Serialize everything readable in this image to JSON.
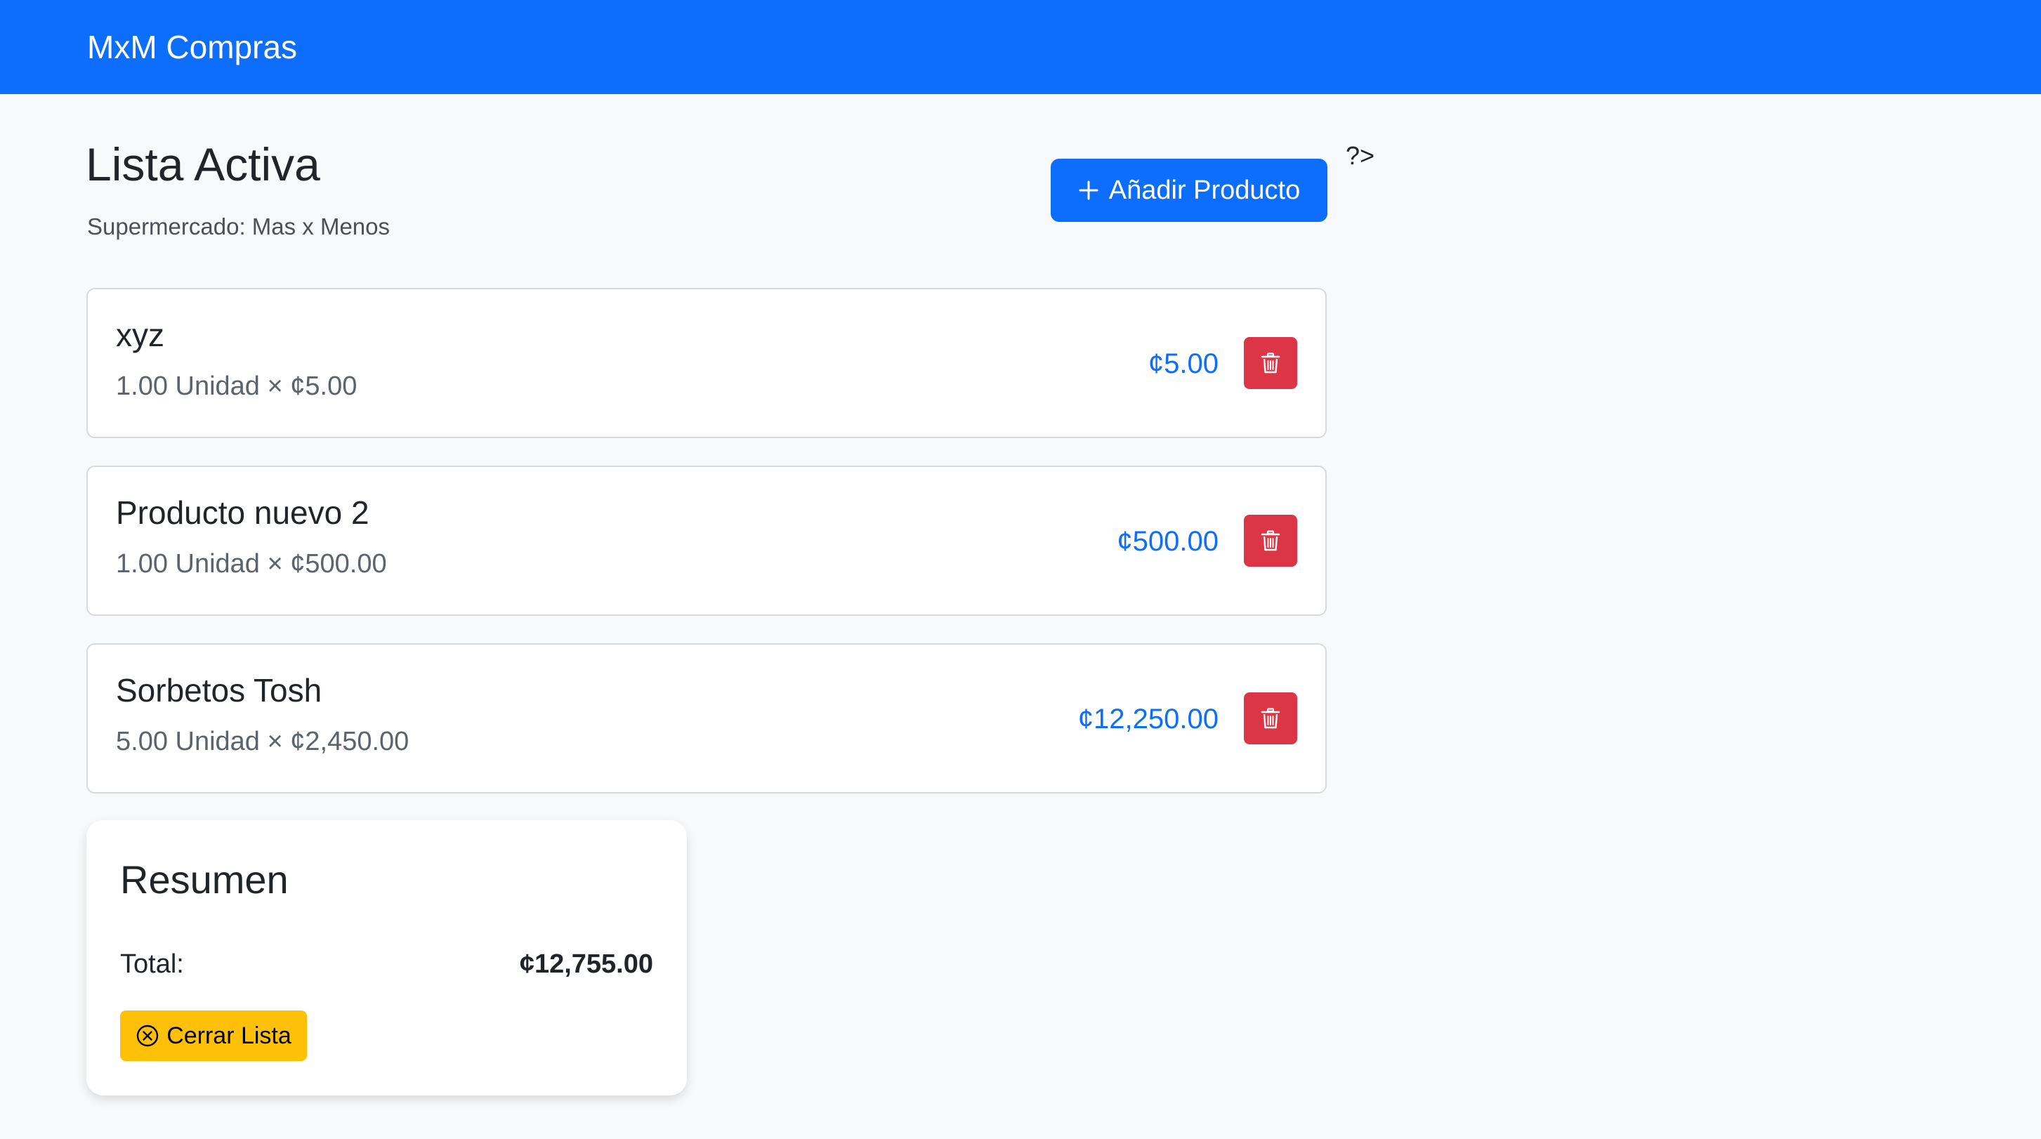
{
  "navbar": {
    "brand": "MxM Compras",
    "color": "#0d6efd"
  },
  "header": {
    "title": "Lista Activa",
    "subtitle": "Supermercado: Mas x Menos",
    "add_button_label": "Añadir Producto",
    "add_button_icon": "plus-icon",
    "stray_text": "?>"
  },
  "items": [
    {
      "name": "xyz",
      "detail": "1.00 Unidad × ¢5.00",
      "price": "¢5.00",
      "delete_icon": "trash-icon"
    },
    {
      "name": "Producto nuevo 2",
      "detail": "1.00 Unidad × ¢500.00",
      "price": "¢500.00",
      "delete_icon": "trash-icon"
    },
    {
      "name": "Sorbetos Tosh",
      "detail": "5.00 Unidad × ¢2,450.00",
      "price": "¢12,250.00",
      "delete_icon": "trash-icon"
    }
  ],
  "summary": {
    "title": "Resumen",
    "total_label": "Total:",
    "total_value": "¢12,755.00",
    "close_button_label": "Cerrar Lista",
    "close_button_icon": "x-circle-icon"
  },
  "colors": {
    "primary": "#0d6efd",
    "danger": "#dc3545",
    "warning": "#ffc107",
    "background": "#f8f9fa"
  }
}
